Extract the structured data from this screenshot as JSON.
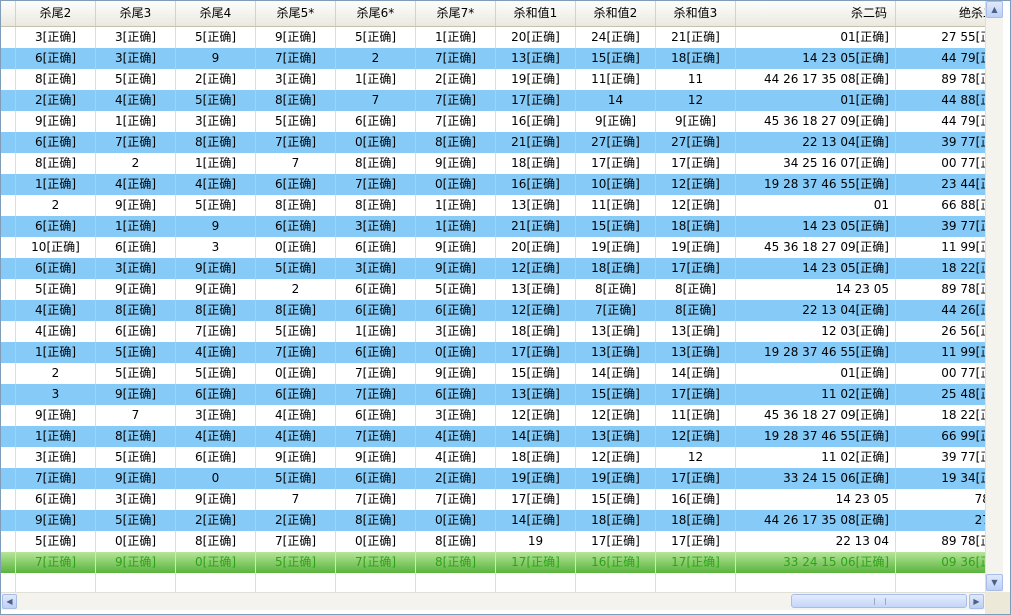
{
  "columns": [
    {
      "label": "杀尾2"
    },
    {
      "label": "杀尾3"
    },
    {
      "label": "杀尾4"
    },
    {
      "label": "杀尾5*"
    },
    {
      "label": "杀尾6*"
    },
    {
      "label": "杀尾7*"
    },
    {
      "label": "杀和值1"
    },
    {
      "label": "杀和值2"
    },
    {
      "label": "杀和值3"
    },
    {
      "label": "杀二码"
    },
    {
      "label": "绝杀二码"
    }
  ],
  "rows": [
    {
      "style": "white",
      "cells": [
        "3[正确]",
        "3[正确]",
        "5[正确]",
        "9[正确]",
        "5[正确]",
        "1[正确]",
        "20[正确]",
        "24[正确]",
        "21[正确]",
        "01[正确]",
        "27 55[正确]"
      ]
    },
    {
      "style": "blue",
      "cells": [
        "6[正确]",
        "3[正确]",
        "9",
        "7[正确]",
        "2",
        "7[正确]",
        "13[正确]",
        "15[正确]",
        "18[正确]",
        "14 23 05[正确]",
        "44 79[正确]"
      ]
    },
    {
      "style": "white",
      "cells": [
        "8[正确]",
        "5[正确]",
        "2[正确]",
        "3[正确]",
        "1[正确]",
        "2[正确]",
        "19[正确]",
        "11[正确]",
        "11",
        "44 26 17 35 08[正确]",
        "89 78[正确]"
      ]
    },
    {
      "style": "blue",
      "cells": [
        "2[正确]",
        "4[正确]",
        "5[正确]",
        "8[正确]",
        "7",
        "7[正确]",
        "17[正确]",
        "14",
        "12",
        "01[正确]",
        "44 88[正确]"
      ]
    },
    {
      "style": "white",
      "cells": [
        "9[正确]",
        "1[正确]",
        "3[正确]",
        "5[正确]",
        "6[正确]",
        "7[正确]",
        "16[正确]",
        "9[正确]",
        "9[正确]",
        "45 36 18 27 09[正确]",
        "44 79[正确]"
      ]
    },
    {
      "style": "blue",
      "cells": [
        "6[正确]",
        "7[正确]",
        "8[正确]",
        "7[正确]",
        "0[正确]",
        "8[正确]",
        "21[正确]",
        "27[正确]",
        "27[正确]",
        "22 13 04[正确]",
        "39 77[正确]"
      ]
    },
    {
      "style": "white",
      "cells": [
        "8[正确]",
        "2",
        "1[正确]",
        "7",
        "8[正确]",
        "9[正确]",
        "18[正确]",
        "17[正确]",
        "17[正确]",
        "34 25 16 07[正确]",
        "00 77[正确]"
      ]
    },
    {
      "style": "blue",
      "cells": [
        "1[正确]",
        "4[正确]",
        "4[正确]",
        "6[正确]",
        "7[正确]",
        "0[正确]",
        "16[正确]",
        "10[正确]",
        "12[正确]",
        "19 28 37 46 55[正确]",
        "23 44[正确]"
      ]
    },
    {
      "style": "white",
      "cells": [
        "2",
        "9[正确]",
        "5[正确]",
        "8[正确]",
        "8[正确]",
        "1[正确]",
        "13[正确]",
        "11[正确]",
        "12[正确]",
        "01",
        "66 88[正确]"
      ]
    },
    {
      "style": "blue",
      "cells": [
        "6[正确]",
        "1[正确]",
        "9",
        "6[正确]",
        "3[正确]",
        "1[正确]",
        "21[正确]",
        "15[正确]",
        "18[正确]",
        "14 23 05[正确]",
        "39 77[正确]"
      ]
    },
    {
      "style": "white",
      "cells": [
        "10[正确]",
        "6[正确]",
        "3",
        "0[正确]",
        "6[正确]",
        "9[正确]",
        "20[正确]",
        "19[正确]",
        "19[正确]",
        "45 36 18 27 09[正确]",
        "11 99[正确]"
      ]
    },
    {
      "style": "blue",
      "cells": [
        "6[正确]",
        "3[正确]",
        "9[正确]",
        "5[正确]",
        "3[正确]",
        "9[正确]",
        "12[正确]",
        "18[正确]",
        "17[正确]",
        "14 23 05[正确]",
        "18 22[正确]"
      ]
    },
    {
      "style": "white",
      "cells": [
        "5[正确]",
        "9[正确]",
        "9[正确]",
        "2",
        "6[正确]",
        "5[正确]",
        "13[正确]",
        "8[正确]",
        "8[正确]",
        "14 23 05",
        "89 78[正确]"
      ]
    },
    {
      "style": "blue",
      "cells": [
        "4[正确]",
        "8[正确]",
        "8[正确]",
        "8[正确]",
        "6[正确]",
        "6[正确]",
        "12[正确]",
        "7[正确]",
        "8[正确]",
        "22 13 04[正确]",
        "44 26[正确]"
      ]
    },
    {
      "style": "white",
      "cells": [
        "4[正确]",
        "6[正确]",
        "7[正确]",
        "5[正确]",
        "1[正确]",
        "3[正确]",
        "18[正确]",
        "13[正确]",
        "13[正确]",
        "12 03[正确]",
        "26 56[正确]"
      ]
    },
    {
      "style": "blue",
      "cells": [
        "1[正确]",
        "5[正确]",
        "4[正确]",
        "7[正确]",
        "6[正确]",
        "0[正确]",
        "17[正确]",
        "13[正确]",
        "13[正确]",
        "19 28 37 46 55[正确]",
        "11 99[正确]"
      ]
    },
    {
      "style": "white",
      "cells": [
        "2",
        "5[正确]",
        "5[正确]",
        "0[正确]",
        "7[正确]",
        "9[正确]",
        "15[正确]",
        "14[正确]",
        "14[正确]",
        "01[正确]",
        "00 77[正确]"
      ]
    },
    {
      "style": "blue",
      "cells": [
        "3",
        "9[正确]",
        "6[正确]",
        "6[正确]",
        "7[正确]",
        "6[正确]",
        "13[正确]",
        "15[正确]",
        "17[正确]",
        "11 02[正确]",
        "25 48[正确]"
      ]
    },
    {
      "style": "white",
      "cells": [
        "9[正确]",
        "7",
        "3[正确]",
        "4[正确]",
        "6[正确]",
        "3[正确]",
        "12[正确]",
        "12[正确]",
        "11[正确]",
        "45 36 18 27 09[正确]",
        "18 22[正确]"
      ]
    },
    {
      "style": "blue",
      "cells": [
        "1[正确]",
        "8[正确]",
        "4[正确]",
        "4[正确]",
        "7[正确]",
        "4[正确]",
        "14[正确]",
        "13[正确]",
        "12[正确]",
        "19 28 37 46 55[正确]",
        "66 99[正确]"
      ]
    },
    {
      "style": "white",
      "cells": [
        "3[正确]",
        "5[正确]",
        "6[正确]",
        "9[正确]",
        "9[正确]",
        "4[正确]",
        "18[正确]",
        "12[正确]",
        "12",
        "11 02[正确]",
        "39 77[正确]"
      ]
    },
    {
      "style": "blue",
      "cells": [
        "7[正确]",
        "9[正确]",
        "0",
        "5[正确]",
        "6[正确]",
        "2[正确]",
        "19[正确]",
        "19[正确]",
        "17[正确]",
        "33 24 15 06[正确]",
        "19 34[正确]"
      ]
    },
    {
      "style": "white",
      "cells": [
        "6[正确]",
        "3[正确]",
        "9[正确]",
        "7",
        "7[正确]",
        "7[正确]",
        "17[正确]",
        "15[正确]",
        "16[正确]",
        "14 23 05",
        "78 79"
      ]
    },
    {
      "style": "blue",
      "cells": [
        "9[正确]",
        "5[正确]",
        "2[正确]",
        "2[正确]",
        "8[正确]",
        "0[正确]",
        "14[正确]",
        "18[正确]",
        "18[正确]",
        "44 26 17 35 08[正确]",
        "27 55"
      ]
    },
    {
      "style": "white",
      "cells": [
        "5[正确]",
        "0[正确]",
        "8[正确]",
        "7[正确]",
        "0[正确]",
        "8[正确]",
        "19",
        "17[正确]",
        "17[正确]",
        "22 13 04",
        "89 78[正确]"
      ]
    },
    {
      "style": "green",
      "cells": [
        "7[正确]",
        "9[正确]",
        "0[正确]",
        "5[正确]",
        "7[正确]",
        "8[正确]",
        "17[正确]",
        "16[正确]",
        "17[正确]",
        "33 24 15 06[正确]",
        "09 36[正确]"
      ]
    }
  ],
  "scrollbars": {
    "up_icon": "chevron-up-icon",
    "down_icon": "chevron-down-icon",
    "left_icon": "chevron-left-icon",
    "right_icon": "chevron-right-icon"
  }
}
